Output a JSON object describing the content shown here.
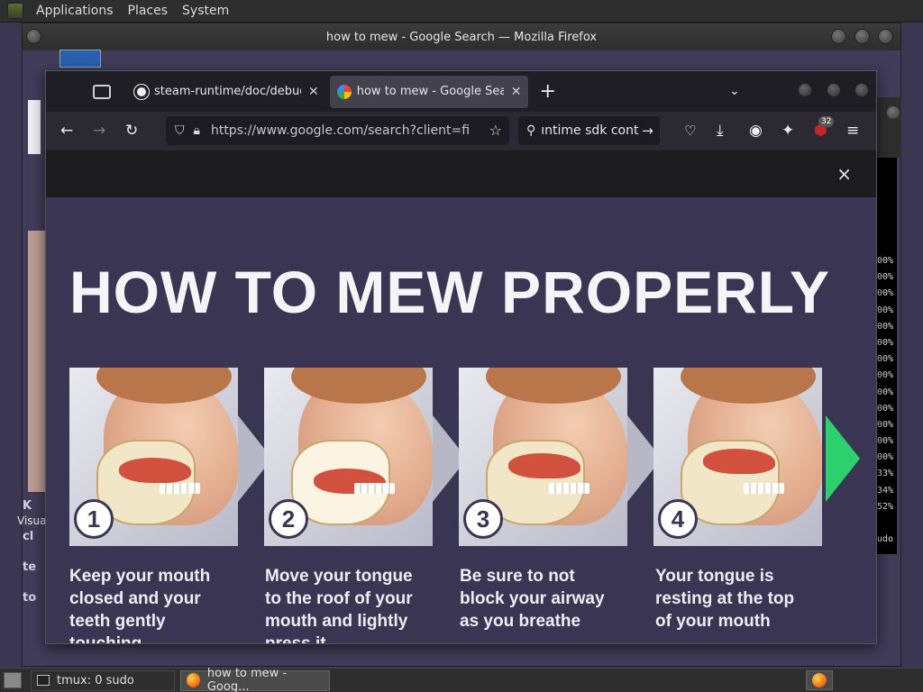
{
  "top_panel": {
    "menus": [
      "Applications",
      "Places",
      "System"
    ]
  },
  "outer_window": {
    "title": "how to mew - Google Search — Mozilla Firefox",
    "left_partial_label": "Visua",
    "left_partial_letters": [
      "K",
      "cl",
      "te",
      "to"
    ]
  },
  "terminal": {
    "lines": [
      "00%",
      "00%",
      "00%",
      "00%",
      "00%",
      "00%",
      "00%",
      "00%",
      "00%",
      "00%",
      "00%",
      "00%",
      "00%",
      "33%",
      "34%",
      "52%",
      "",
      "udo"
    ]
  },
  "firefox": {
    "tabs": [
      {
        "title": "steam-runtime/doc/debug-",
        "favicon": "github-icon",
        "active": false
      },
      {
        "title": "how to mew - Google Search",
        "favicon": "google-icon",
        "active": true
      }
    ],
    "url": "https://www.google.com/search?client=firefox",
    "search_value": "ıntime sdk cont",
    "ublock_count": "32",
    "colors": {
      "tab_active": "#42414d",
      "toolbar": "#2b2a33",
      "background": "#1c1b22"
    }
  },
  "image_viewer": {
    "close_glyph": "×",
    "heading": "HOW TO MEW PROPERLY",
    "steps": [
      {
        "number": "1",
        "caption": "Keep your mouth\nclosed and your\nteeth gently\ntouching"
      },
      {
        "number": "2",
        "caption": "Move your tongue\nto the roof of your\nmouth and lightly\npress it"
      },
      {
        "number": "3",
        "caption": "Be sure to not\nblock your airway\nas you breathe"
      },
      {
        "number": "4",
        "caption": "Your tongue is\nresting at the top\nof your mouth"
      }
    ],
    "colors": {
      "image_bg": "#3a3552",
      "arrow_next": "#2ed06e"
    }
  },
  "taskbar": {
    "tasks": [
      {
        "label": "tmux: 0 sudo",
        "active": false
      },
      {
        "label": "how to mew - Goog...",
        "active": true
      }
    ]
  }
}
